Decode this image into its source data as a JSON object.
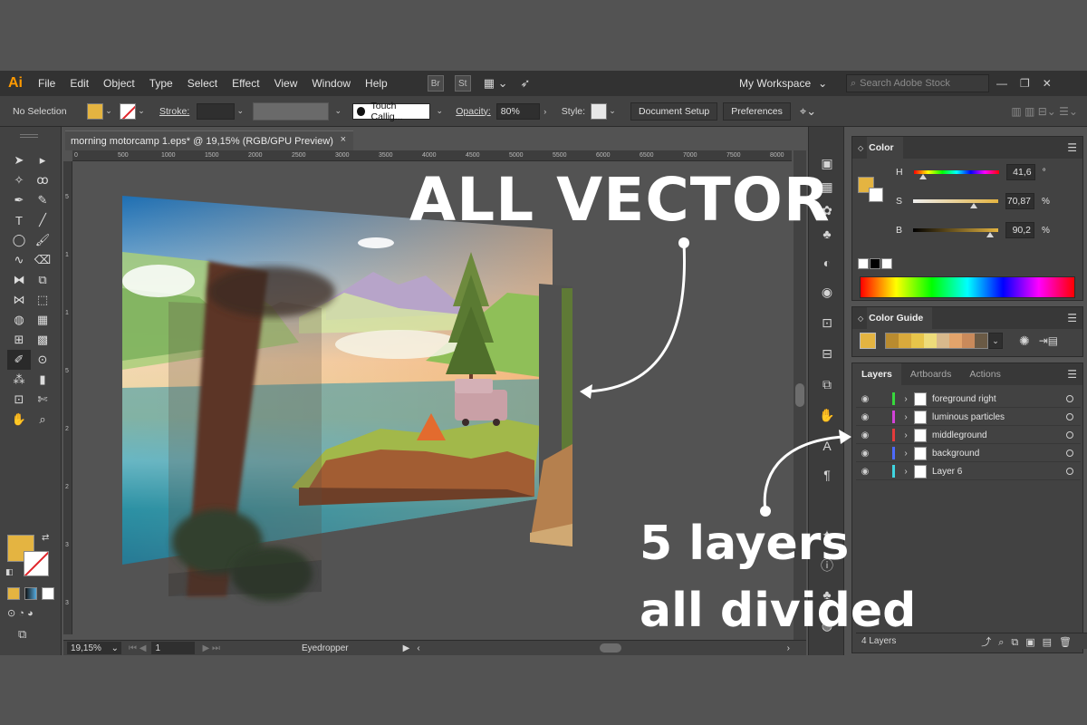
{
  "app": {
    "logo": "Ai",
    "workspace": "My Workspace",
    "search_placeholder": "Search Adobe Stock"
  },
  "menu": [
    "File",
    "Edit",
    "Object",
    "Type",
    "Select",
    "Effect",
    "View",
    "Window",
    "Help"
  ],
  "bridge_icons": [
    "Br",
    "St"
  ],
  "control": {
    "selection": "No Selection",
    "stroke_label": "Stroke:",
    "brush": "Touch Callig...",
    "opacity_label": "Opacity:",
    "opacity_value": "80%",
    "style_label": "Style:",
    "doc_setup": "Document Setup",
    "preferences": "Preferences"
  },
  "document": {
    "tab_title": "morning motorcamp 1.eps* @ 19,15% (RGB/GPU Preview)",
    "close": "×",
    "zoom": "19,15%",
    "page": "1",
    "status_tool": "Eyedropper",
    "ruler_top": [
      "0",
      "500",
      "1000",
      "1500",
      "2000",
      "2500",
      "3000",
      "3500",
      "4000",
      "4500",
      "5000",
      "5500",
      "6000",
      "6500",
      "7000",
      "7500",
      "8000"
    ],
    "ruler_left": [
      "5",
      "1",
      "1",
      "5",
      "2",
      "2",
      "3",
      "3"
    ]
  },
  "color_panel": {
    "title": "Color",
    "h_label": "H",
    "h_value": "41,6",
    "h_unit": "°",
    "h": 41.6,
    "s_label": "S",
    "s_value": "70,87",
    "s_unit": "%",
    "s": 70.87,
    "b_label": "B",
    "b_value": "90,2",
    "b_unit": "%",
    "b": 90.2,
    "fill_color": "#e4b441"
  },
  "color_guide": {
    "title": "Color Guide",
    "swatches": [
      "#b98b2f",
      "#d9a93c",
      "#e8c54a",
      "#eedc7a",
      "#d8b98c",
      "#e3a46b",
      "#c98a5b",
      "#6a5a45"
    ]
  },
  "layers_panel": {
    "tabs": [
      "Layers",
      "Artboards",
      "Actions"
    ],
    "layers": [
      {
        "name": "foreground right",
        "color": "#37d83c"
      },
      {
        "name": "luminous particles",
        "color": "#d342d9"
      },
      {
        "name": "middleground",
        "color": "#e33b3b"
      },
      {
        "name": "background",
        "color": "#4d6bff"
      },
      {
        "name": "Layer 6",
        "color": "#3fd6e0"
      }
    ],
    "footer": "4 Layers"
  },
  "overlay": {
    "title": "ALL VECTOR",
    "line1": "5 layers",
    "line2": "all divided"
  },
  "colors": {
    "accent_orange": "#ff9a00",
    "panel_bg": "#424242",
    "menubar_bg": "#323232"
  }
}
